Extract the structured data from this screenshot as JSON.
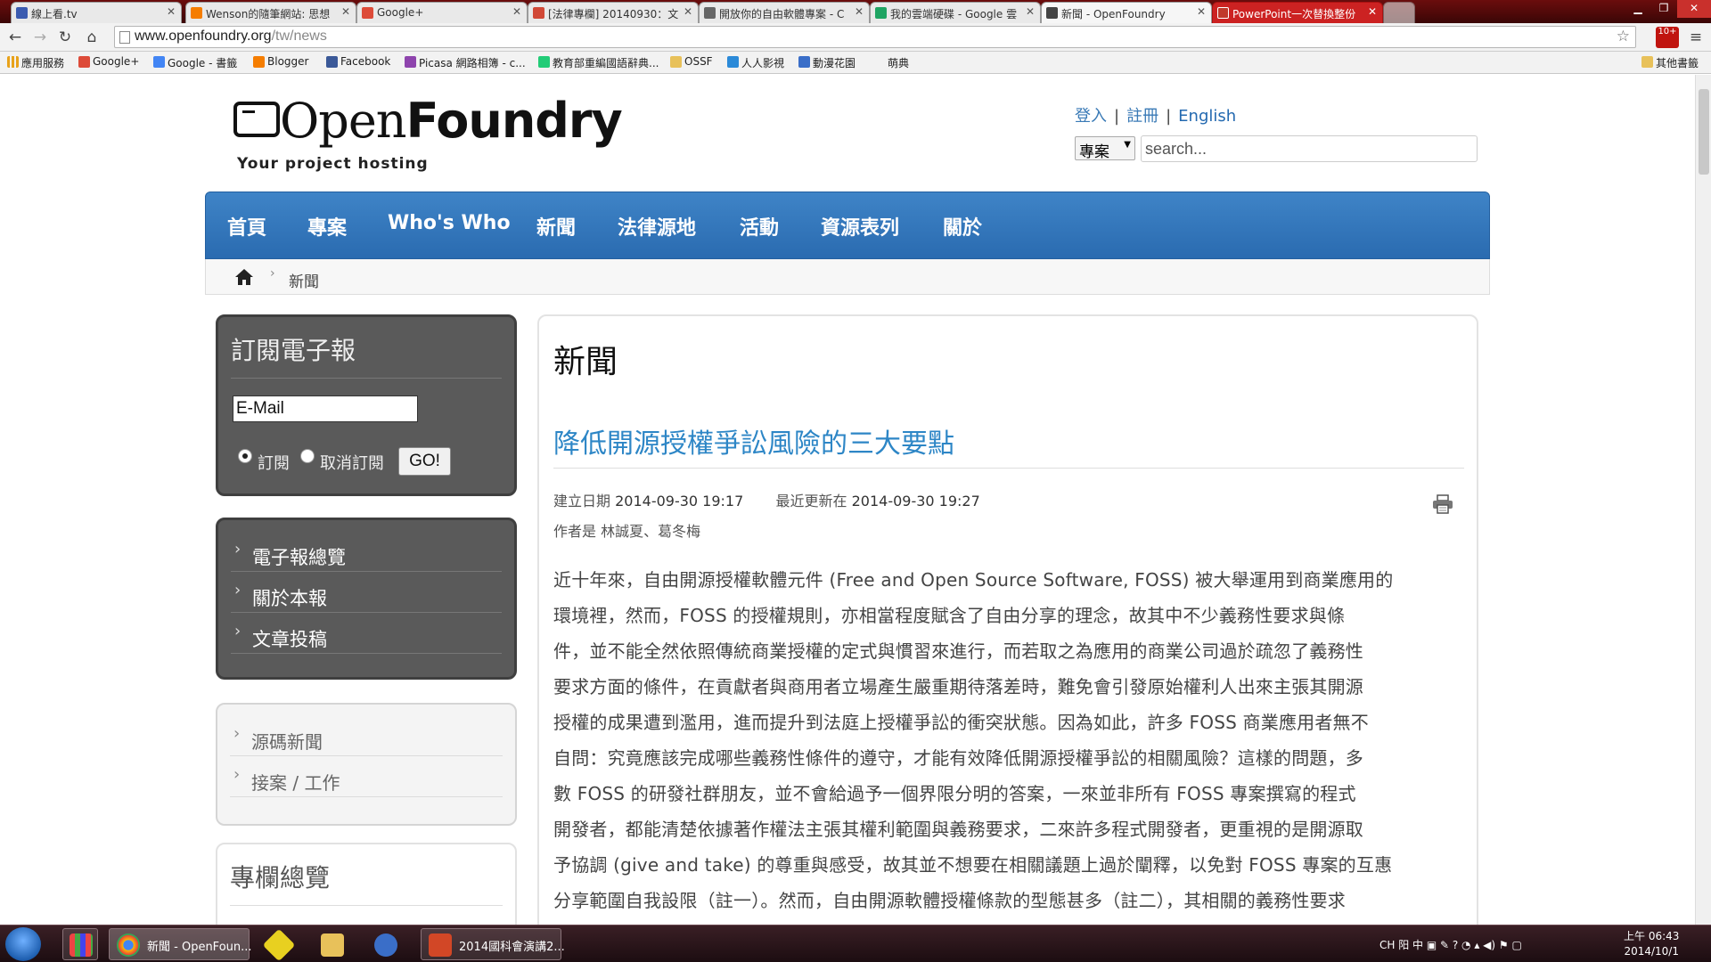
{
  "browser": {
    "tabs": [
      {
        "title": "線上看.tv",
        "icon_color": "#3b5bb0"
      },
      {
        "title": "Wenson的隨筆網站: 思想",
        "icon_color": "#f57d00"
      },
      {
        "title": "Google+",
        "icon_color": "#dd4b39"
      },
      {
        "title": "[法律專欄] 20140930：文",
        "icon_color": "#d14836"
      },
      {
        "title": "開放你的自由軟體專案 - C",
        "icon_color": "#666666"
      },
      {
        "title": "我的雲端硬碟 - Google 雲",
        "icon_color": "#1fa463"
      },
      {
        "title": "新聞 - OpenFoundry",
        "icon_color": "#444444"
      },
      {
        "title": "PowerPoint一次替換整份",
        "icon_color": "#c0392b"
      }
    ],
    "url_host": "www.openfoundry.org",
    "url_path": "/tw/news",
    "bookmarks": [
      {
        "label": "應用服務",
        "color": "#e8a21a"
      },
      {
        "label": "Google+",
        "color": "#dd4b39"
      },
      {
        "label": "Google - 書籤",
        "color": "#4285f4"
      },
      {
        "label": "Blogger",
        "color": "#f57d00"
      },
      {
        "label": "Facebook",
        "color": "#3b5998"
      },
      {
        "label": "Picasa 網路相簿 - c...",
        "color": "#8e44ad"
      },
      {
        "label": "教育部重編國語辭典...",
        "color": "#2c7"
      },
      {
        "label": "OSSF",
        "color": "#e8c15a"
      },
      {
        "label": "人人影視",
        "color": "#2b8ad8"
      },
      {
        "label": "動漫花園",
        "color": "#3a6ec8"
      },
      {
        "label": "萌典",
        "color": "#cccccc"
      }
    ],
    "other_bookmarks": "其他書籤"
  },
  "header": {
    "logo_open": "Open",
    "logo_foundry": "Foundry",
    "logo_tagline": "Your project hosting",
    "login": "登入",
    "register": "註冊",
    "english": "English",
    "search_scope": "專案",
    "search_placeholder": "search..."
  },
  "nav": [
    "首頁",
    "專案",
    "Who's Who",
    "新聞",
    "法律源地",
    "活動",
    "資源表列",
    "關於"
  ],
  "breadcrumb": {
    "current": "新聞"
  },
  "sidebar": {
    "newsletter_title": "訂閱電子報",
    "email_placeholder": "E-Mail",
    "subscribe": "訂閱",
    "unsubscribe": "取消訂閱",
    "go": "GO!",
    "links_dark": [
      "電子報總覽",
      "關於本報",
      "文章投稿"
    ],
    "links_light": [
      "源碼新聞",
      "接案 / 工作"
    ],
    "column_title": "專欄總覽"
  },
  "content": {
    "page_title": "新聞",
    "article_title": "降低開源授權爭訟風險的三大要點",
    "created_label": "建立日期",
    "created": "2014-09-30 19:17",
    "updated_label": "最近更新在",
    "updated": "2014-09-30 19:27",
    "author_label": "作者是",
    "authors": "林誠夏、葛冬梅",
    "body_lines": [
      "近十年來，自由開源授權軟體元件 (Free and Open Source Software, FOSS) 被大舉運用到商業應用的",
      "環境裡，然而，FOSS 的授權規則，亦相當程度賦含了自由分享的理念，故其中不少義務性要求與條",
      "件，並不能全然依照傳統商業授權的定式與慣習來進行，而若取之為應用的商業公司過於疏忽了義務性",
      "要求方面的條件，在貢獻者與商用者立場產生嚴重期待落差時，難免會引發原始權利人出來主張其開源",
      "授權的成果遭到濫用，進而提升到法庭上授權爭訟的衝突狀態。因為如此，許多 FOSS 商業應用者無不",
      "自問：究竟應該完成哪些義務性條件的遵守，才能有效降低開源授權爭訟的相關風險？這樣的問題，多",
      "數 FOSS 的研發社群朋友，並不會給過予一個界限分明的答案，一來並非所有 FOSS 專案撰寫的程式",
      "開發者，都能清楚依據著作權法主張其權利範圍與義務要求，二來許多程式開發者，更重視的是開源取",
      "予協調 (give and take) 的尊重與感受，故其並不想要在相關議題上過於闡釋，以免對 FOSS 專案的互惠",
      "分享範圍自我設限（註一）。然而，自由開源軟體授權條款的型態甚多（註二），其相關的義務性要求"
    ]
  },
  "taskbar": {
    "buttons": [
      {
        "label": "新聞 - OpenFoun...",
        "color": "#e8b020"
      },
      {
        "label": "2014國科會演講2...",
        "color": "#d24726"
      }
    ],
    "tray_text": "CH 阳 中 ▣ ✎ ? ◔ ▴ ◀) ⚑ ▢",
    "time": "上午 06:43",
    "date": "2014/10/1"
  }
}
